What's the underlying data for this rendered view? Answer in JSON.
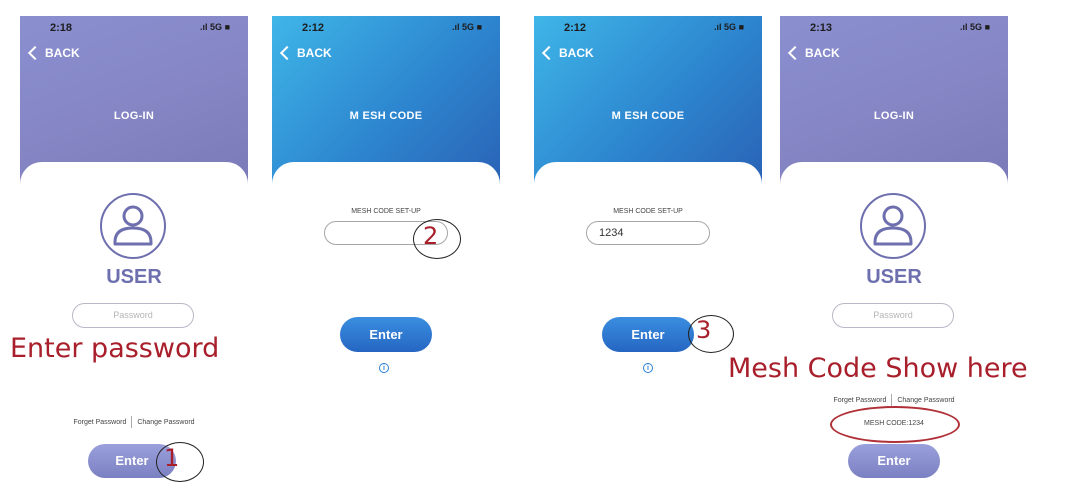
{
  "screens": [
    {
      "time": "2:18",
      "signal": "5G",
      "back": "BACK",
      "title": "LOG-IN",
      "user": "USER",
      "password_placeholder": "Password",
      "forget": "Forget Password",
      "change": "Change Password",
      "enter": "Enter"
    },
    {
      "time": "2:12",
      "signal": "5G",
      "back": "BACK",
      "title": "M ESH CODE",
      "field_label": "MESH CODE SET-UP",
      "field_value": "",
      "enter": "Enter",
      "info": "i"
    },
    {
      "time": "2:12",
      "signal": "5G",
      "back": "BACK",
      "title": "M ESH CODE",
      "field_label": "MESH CODE SET-UP",
      "field_value": "1234",
      "enter": "Enter",
      "info": "i"
    },
    {
      "time": "2:13",
      "signal": "5G",
      "back": "BACK",
      "title": "LOG-IN",
      "user": "USER",
      "password_placeholder": "Password",
      "forget": "Forget Password",
      "change": "Change Password",
      "mesh_code": "MESH CODE:1234",
      "enter": "Enter"
    }
  ],
  "annotations": {
    "enter_password": "Enter password",
    "mesh_code_show": "Mesh Code Show here",
    "step1": "1",
    "step2": "2",
    "step3": "3"
  },
  "colors": {
    "accent_red": "#a81f2b",
    "purple": "#8585c4",
    "blue": "#2d86cf"
  }
}
